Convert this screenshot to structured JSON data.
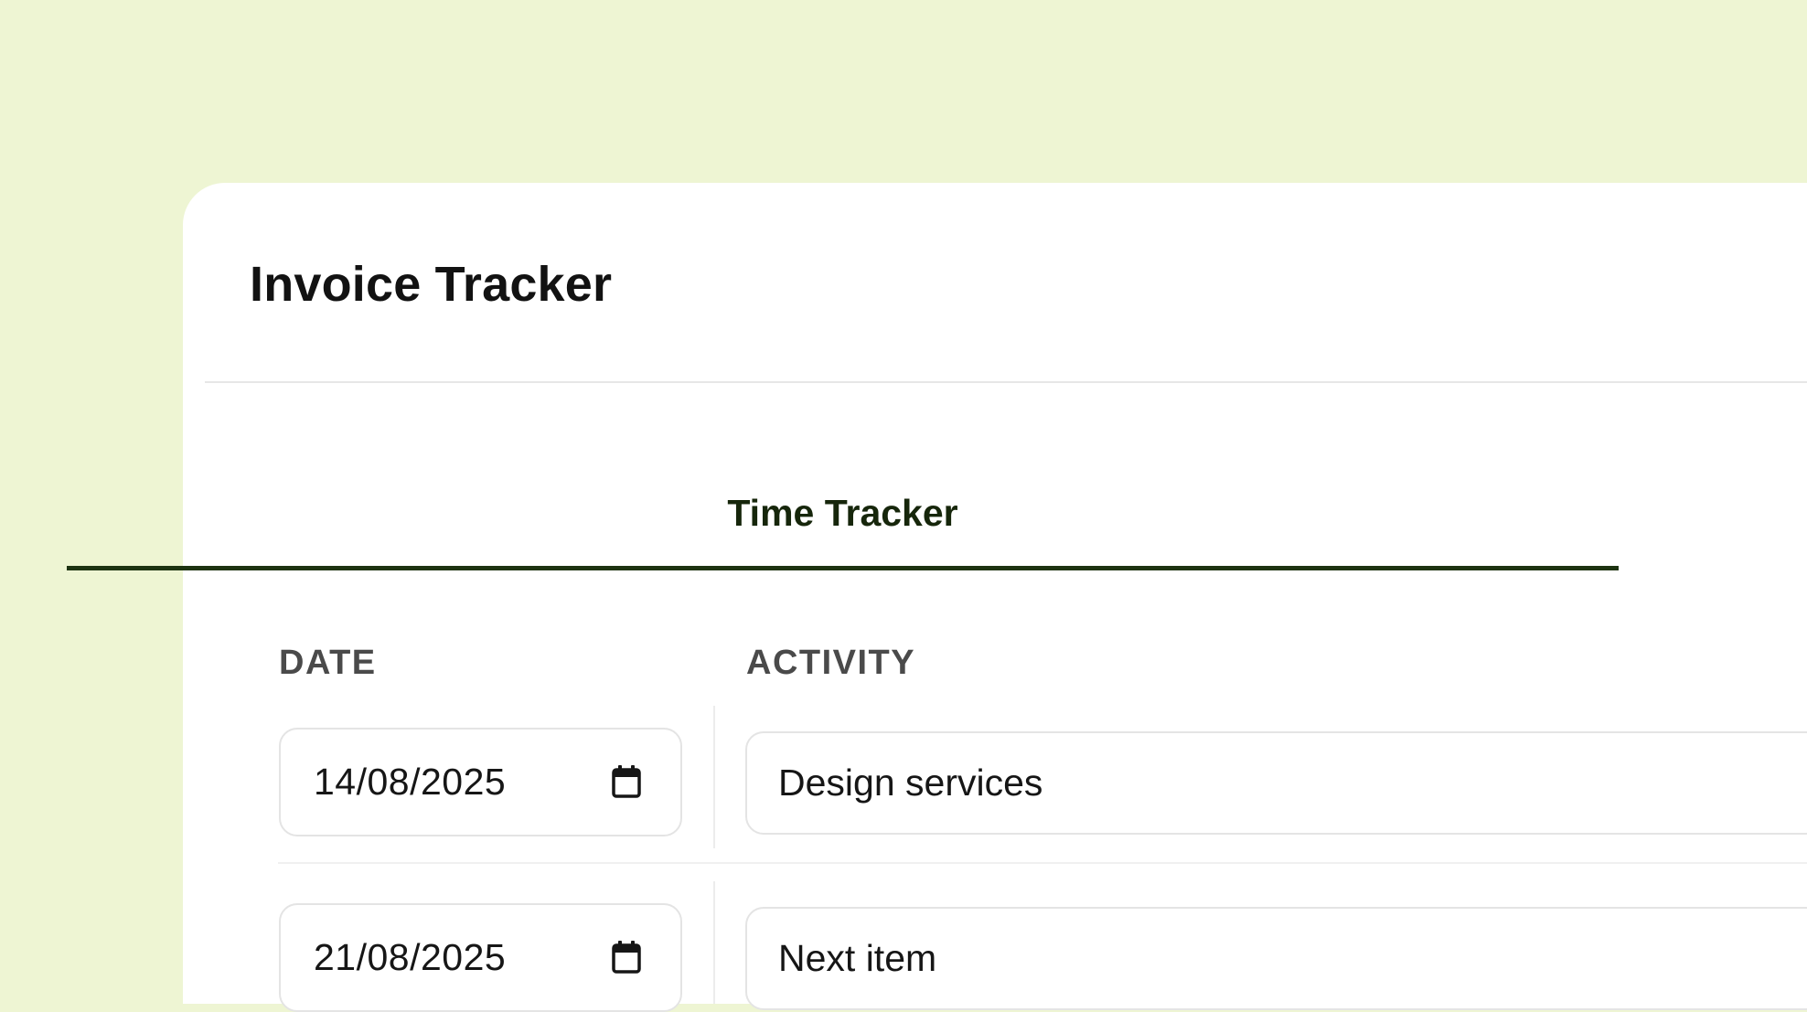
{
  "app": {
    "title": "Invoice Tracker"
  },
  "tabs": [
    {
      "label": "Time Tracker",
      "active": true
    }
  ],
  "table": {
    "columns": [
      "DATE",
      "ACTIVITY"
    ],
    "rows": [
      {
        "date": "14/08/2025",
        "activity": "Design services"
      },
      {
        "date": "21/08/2025",
        "activity": "Next item"
      }
    ]
  },
  "icons": {
    "date_picker": "calendar-icon"
  },
  "colors": {
    "page_background": "#eef5d3",
    "card_background": "#ffffff",
    "accent": "#1d3311",
    "header_text": "#4a4a4a"
  }
}
